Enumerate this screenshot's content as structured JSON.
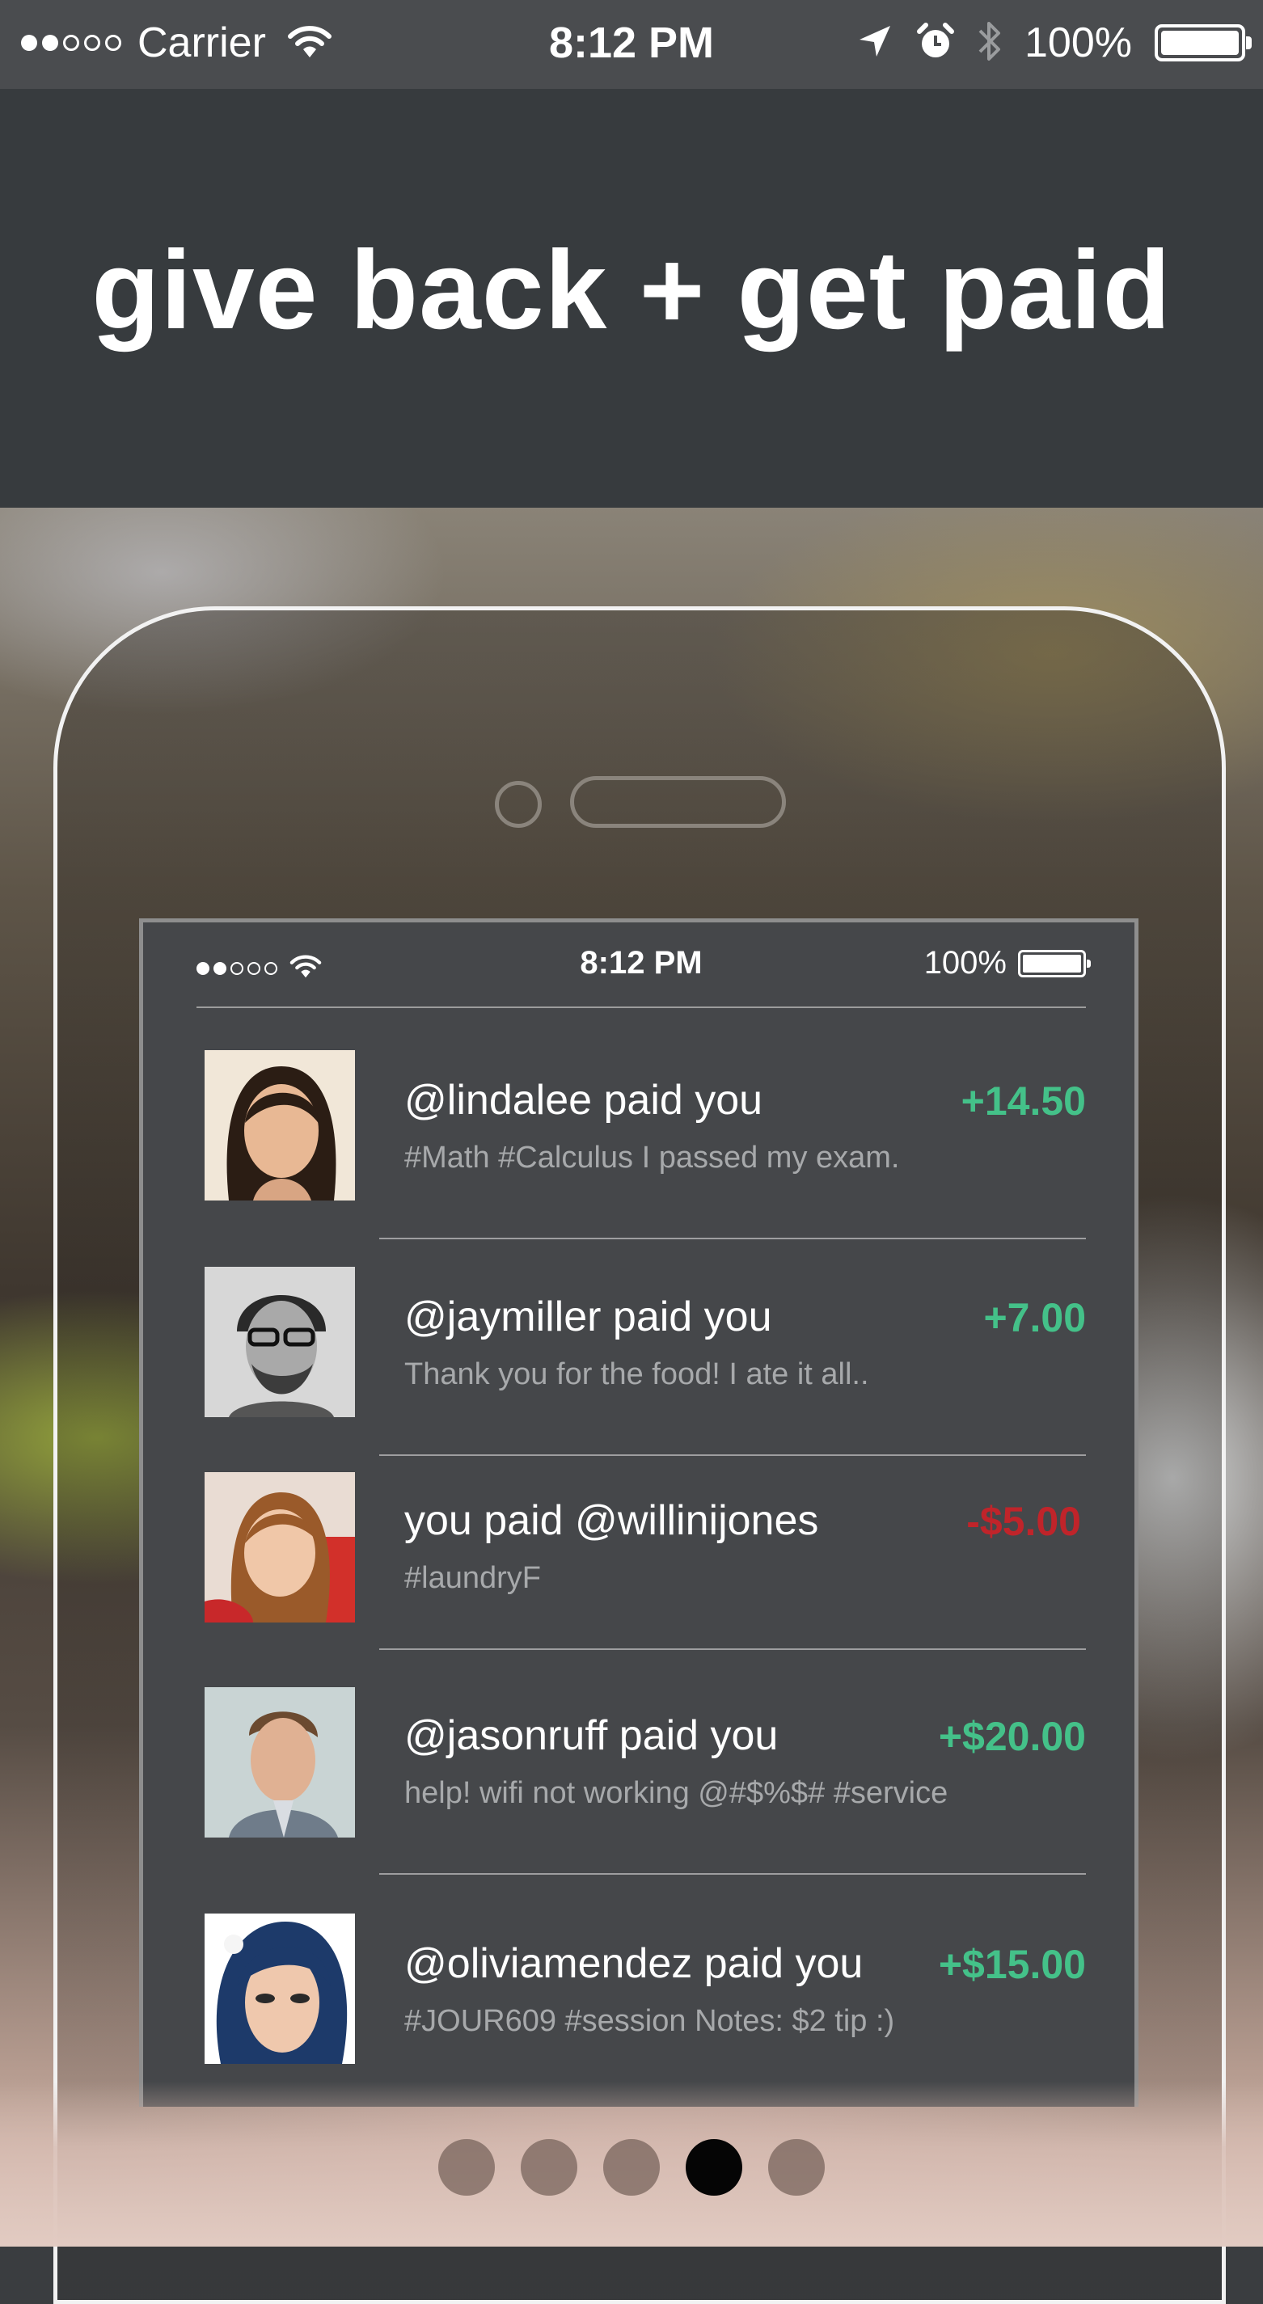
{
  "status_bar": {
    "carrier": "Carrier",
    "time": "8:12 PM",
    "battery": "100%"
  },
  "header": {
    "headline": "give back + get paid"
  },
  "phone": {
    "status_bar": {
      "time": "8:12 PM",
      "battery": "100%"
    },
    "feed": [
      {
        "title": "@lindalee paid you",
        "note": "#Math #Calculus I passed my exam.",
        "amount": "+14.50",
        "direction": "in"
      },
      {
        "title": "@jaymiller paid you",
        "note": "Thank you for the food! I ate it all..",
        "amount": "+7.00",
        "direction": "in"
      },
      {
        "title": "you paid @willinijones",
        "note": "#laundryF",
        "amount": "-$5.00",
        "direction": "out"
      },
      {
        "title": "@jasonruff paid you",
        "note": "help! wifi not working @#$%$# #service",
        "amount": "+$20.00",
        "direction": "in"
      },
      {
        "title": "@oliviamendez paid you",
        "note": "#JOUR609 #session Notes: $2 tip :)",
        "amount": "+$15.00",
        "direction": "in"
      }
    ]
  },
  "pager": {
    "pages": 5,
    "active_index": 3
  },
  "colors": {
    "positive": "#44c189",
    "negative": "#c0242a",
    "header_bg": "#373b3e"
  },
  "icons": [
    "signal-dots-icon",
    "wifi-icon",
    "location-arrow-icon",
    "alarm-clock-icon",
    "bluetooth-icon",
    "battery-icon"
  ]
}
